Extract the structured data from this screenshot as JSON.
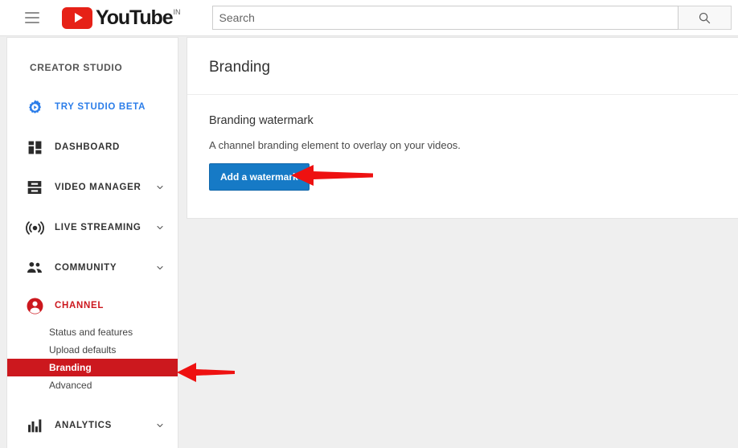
{
  "topbar": {
    "menu_icon": "hamburger-menu-icon",
    "logo": {
      "word": "YouTube",
      "country": "IN",
      "play_icon": "youtube-play-icon"
    },
    "search": {
      "placeholder": "Search",
      "value": "",
      "button_icon": "search-icon"
    }
  },
  "sidebar": {
    "heading": "CREATOR STUDIO",
    "items": [
      {
        "label": "TRY STUDIO BETA",
        "icon": "gear-play-icon",
        "style": "blue",
        "expandable": false
      },
      {
        "label": "DASHBOARD",
        "icon": "dashboard-grid-icon",
        "style": "dark",
        "expandable": false
      },
      {
        "label": "VIDEO MANAGER",
        "icon": "video-manager-icon",
        "style": "dark",
        "expandable": true
      },
      {
        "label": "LIVE STREAMING",
        "icon": "live-broadcast-icon",
        "style": "dark",
        "expandable": true
      },
      {
        "label": "COMMUNITY",
        "icon": "people-icon",
        "style": "dark",
        "expandable": true
      },
      {
        "label": "CHANNEL",
        "icon": "channel-person-icon",
        "style": "red",
        "expandable": false
      }
    ],
    "channel_subitems": [
      {
        "label": "Status and features",
        "active": false
      },
      {
        "label": "Upload defaults",
        "active": false
      },
      {
        "label": "Branding",
        "active": true
      },
      {
        "label": "Advanced",
        "active": false
      }
    ],
    "analytics_item": {
      "label": "ANALYTICS",
      "icon": "bar-chart-icon",
      "style": "dark",
      "expandable": true
    }
  },
  "main": {
    "page_title": "Branding",
    "section_title": "Branding watermark",
    "section_description": "A channel branding element to overlay on your videos.",
    "add_watermark_button": "Add a watermark"
  },
  "annotations": [
    {
      "name": "arrow-pointing-to-add-watermark-button",
      "direction": "left",
      "color": "#ee1111"
    },
    {
      "name": "arrow-pointing-to-branding-menu-item",
      "direction": "left",
      "color": "#ee1111"
    }
  ],
  "colors": {
    "youtube_red": "#e62117",
    "active_red": "#cc181e",
    "button_blue": "#167ac6",
    "beta_blue": "#2b7de9",
    "page_background": "#efefef",
    "annotation_red": "#ee1111"
  }
}
